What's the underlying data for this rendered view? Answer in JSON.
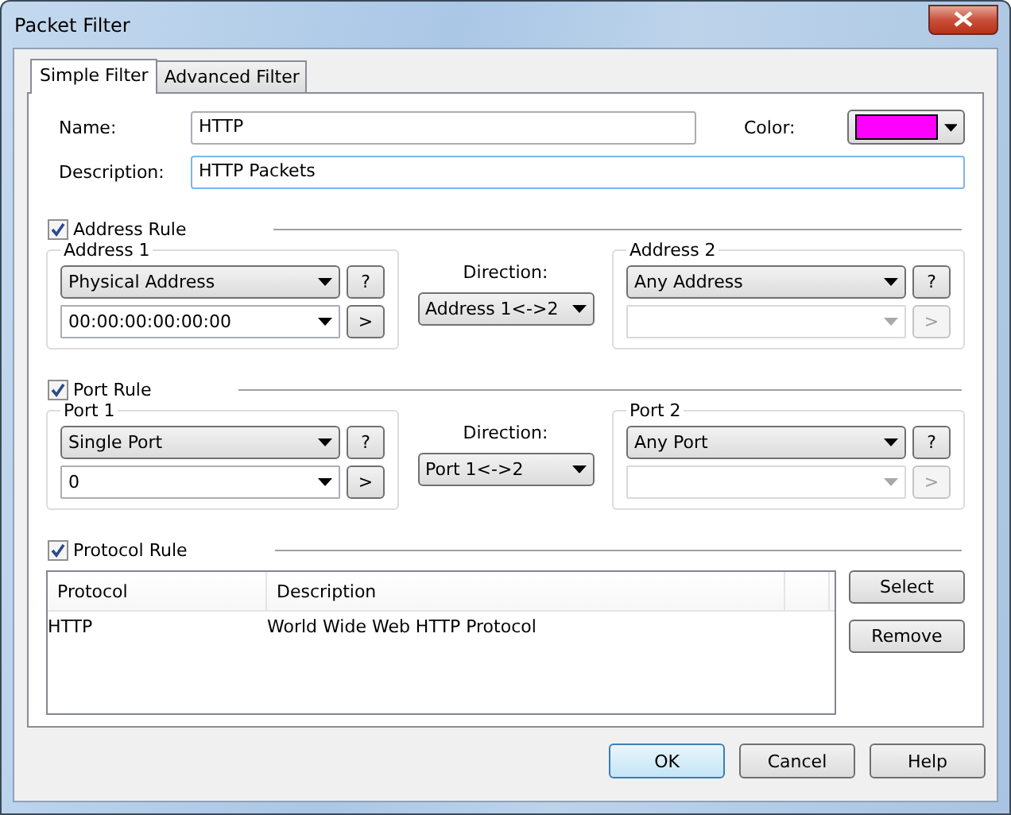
{
  "window": {
    "title": "Packet Filter"
  },
  "tabs": [
    {
      "label": "Simple Filter",
      "selected": true
    },
    {
      "label": "Advanced Filter",
      "selected": false
    }
  ],
  "name": {
    "label": "Name:",
    "value": "HTTP"
  },
  "color": {
    "label": "Color:",
    "color": "#ff00ff"
  },
  "description": {
    "label": "Description:",
    "value": "HTTP Packets"
  },
  "rules": [
    {
      "kind": "endpoints",
      "label": "Address Rule",
      "checked": true,
      "left": {
        "title": "Address 1",
        "mode": "Physical Address",
        "help": "?",
        "value": "00:00:00:00:00:00",
        "add": ">",
        "disabled": false
      },
      "direction": {
        "label": "Direction:",
        "value": "Address 1<->2"
      },
      "right": {
        "title": "Address 2",
        "mode": "Any Address",
        "help": "?",
        "add": ">",
        "disabled": true
      }
    },
    {
      "kind": "endpoints",
      "label": "Port Rule",
      "checked": true,
      "left": {
        "title": "Port 1",
        "mode": "Single Port",
        "help": "?",
        "value": "0",
        "add": ">",
        "disabled": false
      },
      "direction": {
        "label": "Direction:",
        "value": "Port 1<->2"
      },
      "right": {
        "title": "Port 2",
        "mode": "Any Port",
        "help": "?",
        "add": ">",
        "disabled": true
      }
    },
    {
      "kind": "list",
      "label": "Protocol Rule",
      "checked": true,
      "columns": [
        "Protocol",
        "Description"
      ],
      "rows": [
        [
          "HTTP",
          "World Wide Web HTTP Protocol"
        ]
      ],
      "buttons": [
        "Select",
        "Remove"
      ]
    }
  ],
  "buttons": [
    {
      "label": "OK",
      "default": true
    },
    {
      "label": "Cancel",
      "default": false
    },
    {
      "label": "Help",
      "default": false
    }
  ]
}
